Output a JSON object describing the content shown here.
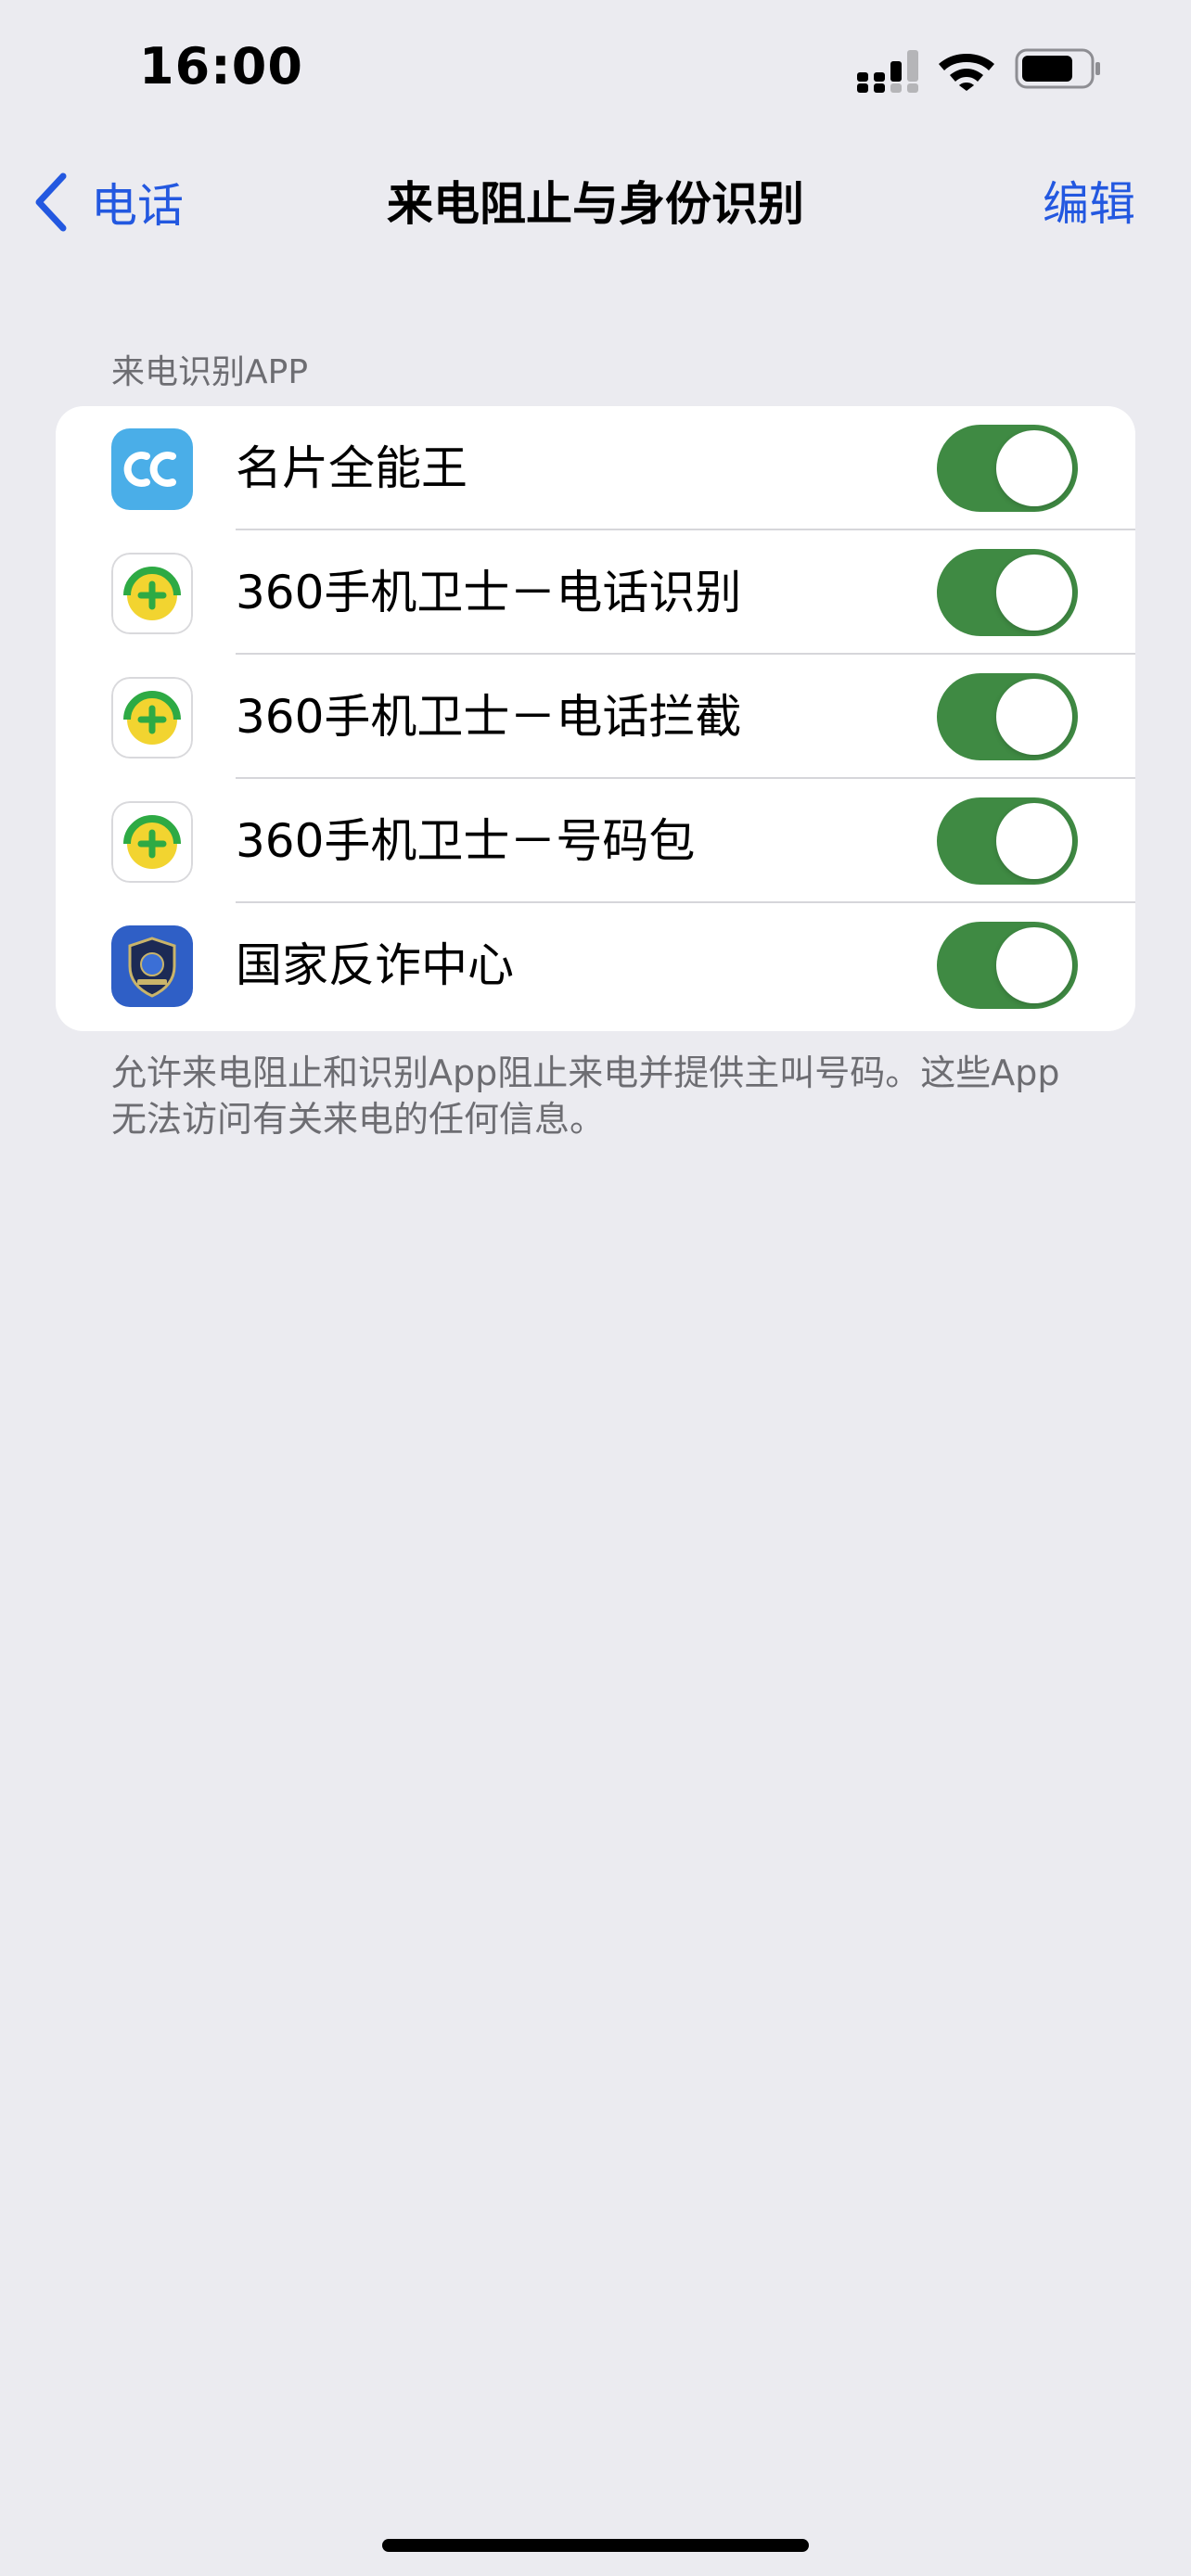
{
  "status_bar": {
    "time": "16:00",
    "icons": [
      "cellular-signal-icon",
      "wifi-icon",
      "battery-icon"
    ]
  },
  "nav": {
    "back_label": "电话",
    "title": "来电阻止与身份识别",
    "edit_label": "编辑"
  },
  "section": {
    "header": "来电识别APP",
    "footer": "允许来电阻止和识别App阻止来电并提供主叫号码。这些App无法访问有关来电的任何信息。",
    "apps": [
      {
        "name": "名片全能王",
        "icon": "camcard-app-icon",
        "enabled": true
      },
      {
        "name": "360手机卫士－电话识别",
        "icon": "360-security-app-icon",
        "enabled": true
      },
      {
        "name": "360手机卫士－电话拦截",
        "icon": "360-security-app-icon",
        "enabled": true
      },
      {
        "name": "360手机卫士－号码包",
        "icon": "360-security-app-icon",
        "enabled": true
      },
      {
        "name": "国家反诈中心",
        "icon": "anti-fraud-app-icon",
        "enabled": true
      }
    ]
  },
  "colors": {
    "accent": "#2358e0",
    "toggle_on": "#3f8a43",
    "background": "#ebebf0",
    "secondary_text": "#6d6d72"
  }
}
